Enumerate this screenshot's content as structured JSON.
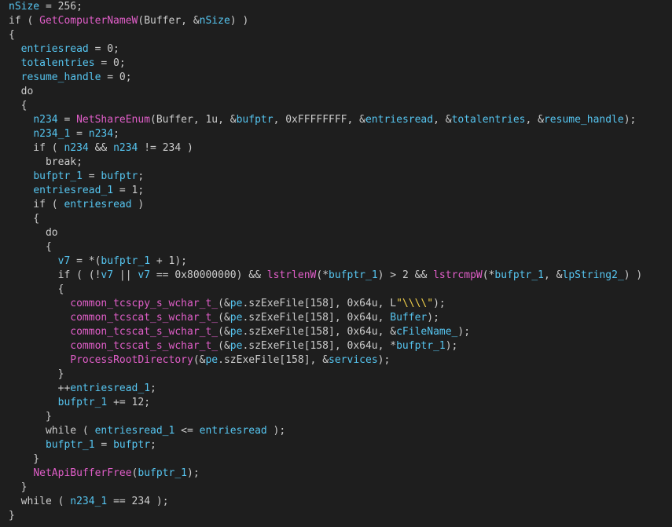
{
  "editor": {
    "colors": {
      "background": "#1e1e1e",
      "text": "#cccccc",
      "variable": "#56c5f0",
      "function": "#e05ec8",
      "string": "#f2d14b"
    },
    "lines": [
      [
        {
          "t": "nSize",
          "c": "var"
        },
        {
          "t": " = 256;",
          "c": "plain"
        }
      ],
      [
        {
          "t": "if ( ",
          "c": "plain"
        },
        {
          "t": "GetComputerNameW",
          "c": "func"
        },
        {
          "t": "(Buffer, &",
          "c": "plain"
        },
        {
          "t": "nSize",
          "c": "var"
        },
        {
          "t": ") )",
          "c": "plain"
        }
      ],
      [
        {
          "t": "{",
          "c": "plain"
        }
      ],
      [
        {
          "t": "  ",
          "c": "plain"
        },
        {
          "t": "entriesread",
          "c": "var"
        },
        {
          "t": " = 0;",
          "c": "plain"
        }
      ],
      [
        {
          "t": "  ",
          "c": "plain"
        },
        {
          "t": "totalentries",
          "c": "var"
        },
        {
          "t": " = 0;",
          "c": "plain"
        }
      ],
      [
        {
          "t": "  ",
          "c": "plain"
        },
        {
          "t": "resume_handle",
          "c": "var"
        },
        {
          "t": " = 0;",
          "c": "plain"
        }
      ],
      [
        {
          "t": "  do",
          "c": "plain"
        }
      ],
      [
        {
          "t": "  {",
          "c": "plain"
        }
      ],
      [
        {
          "t": "    ",
          "c": "plain"
        },
        {
          "t": "n234",
          "c": "var"
        },
        {
          "t": " = ",
          "c": "plain"
        },
        {
          "t": "NetShareEnum",
          "c": "func"
        },
        {
          "t": "(Buffer, 1u, &",
          "c": "plain"
        },
        {
          "t": "bufptr",
          "c": "var"
        },
        {
          "t": ", 0xFFFFFFFF, &",
          "c": "plain"
        },
        {
          "t": "entriesread",
          "c": "var"
        },
        {
          "t": ", &",
          "c": "plain"
        },
        {
          "t": "totalentries",
          "c": "var"
        },
        {
          "t": ", &",
          "c": "plain"
        },
        {
          "t": "resume_handle",
          "c": "var"
        },
        {
          "t": ");",
          "c": "plain"
        }
      ],
      [
        {
          "t": "    ",
          "c": "plain"
        },
        {
          "t": "n234_1",
          "c": "var"
        },
        {
          "t": " = ",
          "c": "plain"
        },
        {
          "t": "n234",
          "c": "var"
        },
        {
          "t": ";",
          "c": "plain"
        }
      ],
      [
        {
          "t": "    if ( ",
          "c": "plain"
        },
        {
          "t": "n234",
          "c": "var"
        },
        {
          "t": " && ",
          "c": "plain"
        },
        {
          "t": "n234",
          "c": "var"
        },
        {
          "t": " != 234 )",
          "c": "plain"
        }
      ],
      [
        {
          "t": "      break;",
          "c": "plain"
        }
      ],
      [
        {
          "t": "    ",
          "c": "plain"
        },
        {
          "t": "bufptr_1",
          "c": "var"
        },
        {
          "t": " = ",
          "c": "plain"
        },
        {
          "t": "bufptr",
          "c": "var"
        },
        {
          "t": ";",
          "c": "plain"
        }
      ],
      [
        {
          "t": "    ",
          "c": "plain"
        },
        {
          "t": "entriesread_1",
          "c": "var"
        },
        {
          "t": " = 1;",
          "c": "plain"
        }
      ],
      [
        {
          "t": "    if ( ",
          "c": "plain"
        },
        {
          "t": "entriesread",
          "c": "var"
        },
        {
          "t": " )",
          "c": "plain"
        }
      ],
      [
        {
          "t": "    {",
          "c": "plain"
        }
      ],
      [
        {
          "t": "      do",
          "c": "plain"
        }
      ],
      [
        {
          "t": "      {",
          "c": "plain"
        }
      ],
      [
        {
          "t": "        ",
          "c": "plain"
        },
        {
          "t": "v7",
          "c": "var"
        },
        {
          "t": " = *(",
          "c": "plain"
        },
        {
          "t": "bufptr_1",
          "c": "var"
        },
        {
          "t": " + 1);",
          "c": "plain"
        }
      ],
      [
        {
          "t": "        if ( (!",
          "c": "plain"
        },
        {
          "t": "v7",
          "c": "var"
        },
        {
          "t": " || ",
          "c": "plain"
        },
        {
          "t": "v7",
          "c": "var"
        },
        {
          "t": " == 0x80000000) && ",
          "c": "plain"
        },
        {
          "t": "lstrlenW",
          "c": "func"
        },
        {
          "t": "(*",
          "c": "plain"
        },
        {
          "t": "bufptr_1",
          "c": "var"
        },
        {
          "t": ") > 2 && ",
          "c": "plain"
        },
        {
          "t": "lstrcmpW",
          "c": "func"
        },
        {
          "t": "(*",
          "c": "plain"
        },
        {
          "t": "bufptr_1",
          "c": "var"
        },
        {
          "t": ", &",
          "c": "plain"
        },
        {
          "t": "lpString2_",
          "c": "var"
        },
        {
          "t": ") )",
          "c": "plain"
        }
      ],
      [
        {
          "t": "        {",
          "c": "plain"
        }
      ],
      [
        {
          "t": "          ",
          "c": "plain"
        },
        {
          "t": "common_tcscpy_s_wchar_t_",
          "c": "func"
        },
        {
          "t": "(&",
          "c": "plain"
        },
        {
          "t": "pe",
          "c": "var"
        },
        {
          "t": ".szExeFile[158], 0x64u, L",
          "c": "plain"
        },
        {
          "t": "\"\\\\\\\\\"",
          "c": "str"
        },
        {
          "t": ");",
          "c": "plain"
        }
      ],
      [
        {
          "t": "          ",
          "c": "plain"
        },
        {
          "t": "common_tcscat_s_wchar_t_",
          "c": "func"
        },
        {
          "t": "(&",
          "c": "plain"
        },
        {
          "t": "pe",
          "c": "var"
        },
        {
          "t": ".szExeFile[158], 0x64u, ",
          "c": "plain"
        },
        {
          "t": "Buffer",
          "c": "var"
        },
        {
          "t": ");",
          "c": "plain"
        }
      ],
      [
        {
          "t": "          ",
          "c": "plain"
        },
        {
          "t": "common_tcscat_s_wchar_t_",
          "c": "func"
        },
        {
          "t": "(&",
          "c": "plain"
        },
        {
          "t": "pe",
          "c": "var"
        },
        {
          "t": ".szExeFile[158], 0x64u, &",
          "c": "plain"
        },
        {
          "t": "cFileName_",
          "c": "var"
        },
        {
          "t": ");",
          "c": "plain"
        }
      ],
      [
        {
          "t": "          ",
          "c": "plain"
        },
        {
          "t": "common_tcscat_s_wchar_t_",
          "c": "func"
        },
        {
          "t": "(&",
          "c": "plain"
        },
        {
          "t": "pe",
          "c": "var"
        },
        {
          "t": ".szExeFile[158], 0x64u, *",
          "c": "plain"
        },
        {
          "t": "bufptr_1",
          "c": "var"
        },
        {
          "t": ");",
          "c": "plain"
        }
      ],
      [
        {
          "t": "          ",
          "c": "plain"
        },
        {
          "t": "ProcessRootDirectory",
          "c": "func"
        },
        {
          "t": "(&",
          "c": "plain"
        },
        {
          "t": "pe",
          "c": "var"
        },
        {
          "t": ".szExeFile[158], &",
          "c": "plain"
        },
        {
          "t": "services",
          "c": "var"
        },
        {
          "t": ");",
          "c": "plain"
        }
      ],
      [
        {
          "t": "        }",
          "c": "plain"
        }
      ],
      [
        {
          "t": "        ++",
          "c": "plain"
        },
        {
          "t": "entriesread_1",
          "c": "var"
        },
        {
          "t": ";",
          "c": "plain"
        }
      ],
      [
        {
          "t": "        ",
          "c": "plain"
        },
        {
          "t": "bufptr_1",
          "c": "var"
        },
        {
          "t": " += 12;",
          "c": "plain"
        }
      ],
      [
        {
          "t": "      }",
          "c": "plain"
        }
      ],
      [
        {
          "t": "      while ( ",
          "c": "plain"
        },
        {
          "t": "entriesread_1",
          "c": "var"
        },
        {
          "t": " <= ",
          "c": "plain"
        },
        {
          "t": "entriesread",
          "c": "var"
        },
        {
          "t": " );",
          "c": "plain"
        }
      ],
      [
        {
          "t": "      ",
          "c": "plain"
        },
        {
          "t": "bufptr_1",
          "c": "var"
        },
        {
          "t": " = ",
          "c": "plain"
        },
        {
          "t": "bufptr",
          "c": "var"
        },
        {
          "t": ";",
          "c": "plain"
        }
      ],
      [
        {
          "t": "    }",
          "c": "plain"
        }
      ],
      [
        {
          "t": "    ",
          "c": "plain"
        },
        {
          "t": "NetApiBufferFree",
          "c": "func"
        },
        {
          "t": "(",
          "c": "plain"
        },
        {
          "t": "bufptr_1",
          "c": "var"
        },
        {
          "t": ");",
          "c": "plain"
        }
      ],
      [
        {
          "t": "  }",
          "c": "plain"
        }
      ],
      [
        {
          "t": "  while ( ",
          "c": "plain"
        },
        {
          "t": "n234_1",
          "c": "var"
        },
        {
          "t": " == 234 );",
          "c": "plain"
        }
      ],
      [
        {
          "t": "}",
          "c": "plain"
        }
      ]
    ]
  }
}
